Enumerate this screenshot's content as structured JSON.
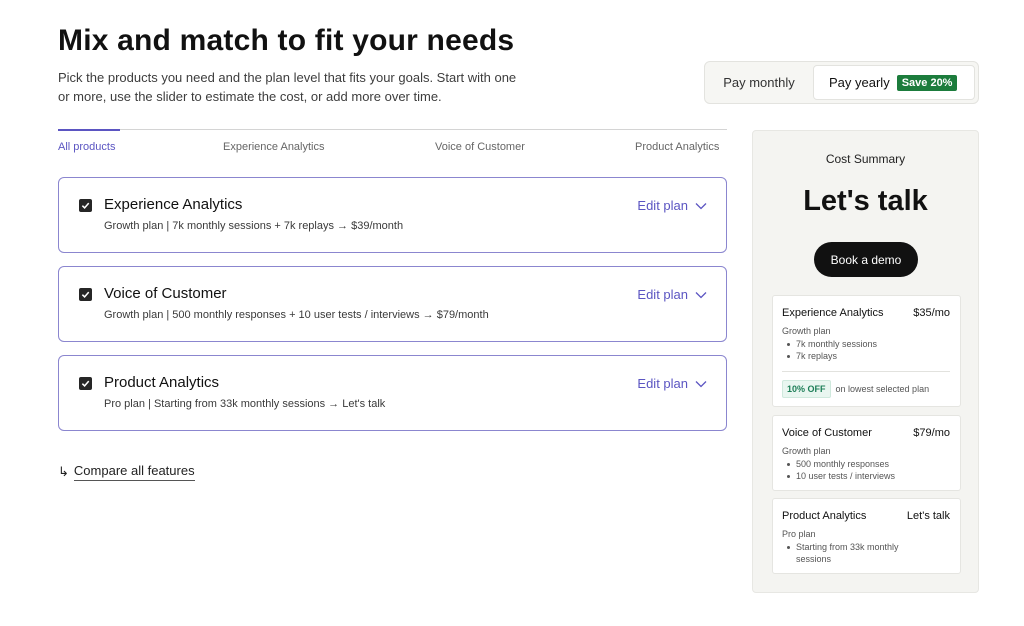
{
  "header": {
    "title": "Mix and match to fit your needs",
    "subtitle": "Pick the products you need and the plan level that fits your goals. Start with one or more, use the slider to estimate the cost, or add more over time."
  },
  "billing_toggle": {
    "monthly_label": "Pay monthly",
    "yearly_label": "Pay yearly",
    "save_badge": "Save 20%",
    "selected": "yearly"
  },
  "tabs": [
    {
      "label": "All products",
      "active": true
    },
    {
      "label": "Experience Analytics",
      "active": false
    },
    {
      "label": "Voice of Customer",
      "active": false
    },
    {
      "label": "Product Analytics",
      "active": false
    }
  ],
  "products": [
    {
      "title": "Experience Analytics",
      "description": "Growth plan | 7k monthly sessions + 7k replays  →  $39/month",
      "edit_label": "Edit plan",
      "checked": true
    },
    {
      "title": "Voice of Customer",
      "description": "Growth plan | 500 monthly responses + 10 user tests / interviews  →  $79/month",
      "edit_label": "Edit plan",
      "checked": true
    },
    {
      "title": "Product Analytics",
      "description": "Pro plan | Starting from 33k monthly sessions  →  Let's talk",
      "edit_label": "Edit plan",
      "checked": true
    }
  ],
  "compare": {
    "arrow": "↳",
    "label": "Compare all features"
  },
  "summary": {
    "heading": "Cost Summary",
    "price": "Let's talk",
    "demo_button": "Book a demo",
    "items": [
      {
        "name": "Experience Analytics",
        "price": "$35/mo",
        "plan": "Growth plan",
        "features": [
          "7k monthly sessions",
          "7k replays"
        ],
        "discount_badge": "10% OFF",
        "discount_text": "on lowest selected plan"
      },
      {
        "name": "Voice of Customer",
        "price": "$79/mo",
        "plan": "Growth plan",
        "features": [
          "500 monthly responses",
          "10 user tests / interviews"
        ]
      },
      {
        "name": "Product Analytics",
        "price": "Let's talk",
        "plan": "Pro plan",
        "features": [
          "Starting from 33k monthly sessions"
        ]
      }
    ]
  },
  "colors": {
    "accent": "#5b55c2",
    "save_green": "#1c7c3c",
    "discount_green": "#1d7e57",
    "card_border": "#8b86cf"
  }
}
